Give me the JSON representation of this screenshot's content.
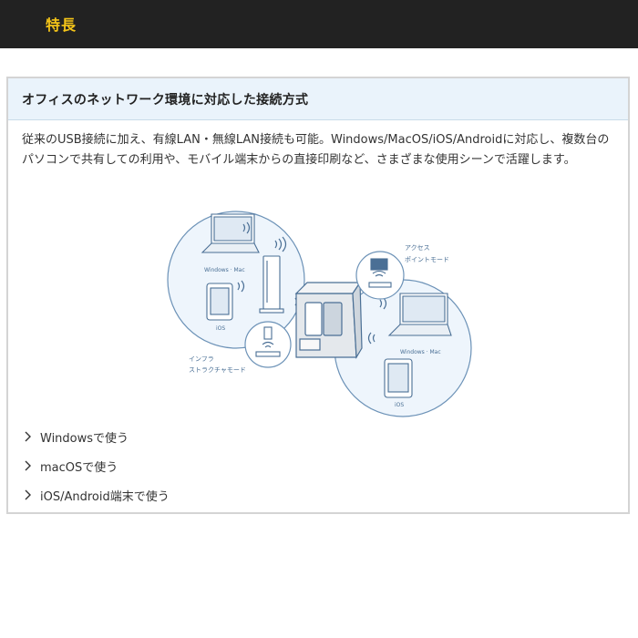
{
  "header": {
    "title": "特長"
  },
  "section": {
    "heading": "オフィスのネットワーク環境に対応した接続方式",
    "description": "従来のUSB接続に加え、有線LAN・無線LAN接続も可能。Windows/MacOS/iOS/Androidに対応し、複数台のパソコンで共有しての利用や、モバイル端末からの直接印刷など、さまざまな使用シーンで活躍します。"
  },
  "illustration": {
    "windows_mac_label_left": "Windows · Mac",
    "ios_label_left": "iOS",
    "infra_label_1": "インフラ",
    "infra_label_2": "ストラクチャモード",
    "access_label_1": "アクセス",
    "access_label_2": "ポイントモード",
    "windows_mac_label_right": "Windows · Mac",
    "ios_label_right": "iOS"
  },
  "links": [
    {
      "label": "Windowsで使う"
    },
    {
      "label": "macOSで使う"
    },
    {
      "label": "iOS/Android端末で使う"
    }
  ],
  "colors": {
    "header_bg": "#222222",
    "header_title": "#f5c518",
    "section_head_bg": "#eaf3fb",
    "circle_fill": "#eef5fc",
    "line": "#4a6f95"
  }
}
